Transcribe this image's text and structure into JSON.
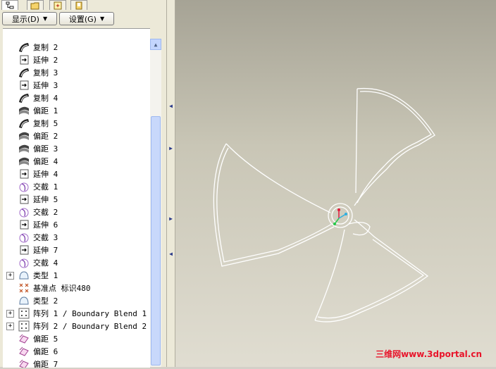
{
  "toolbar": {
    "show_label": "显示(D)",
    "settings_label": "设置(G)"
  },
  "tree_items": [
    {
      "label": "复制 2",
      "icon": "copy-surface-icon"
    },
    {
      "label": "延伸 2",
      "icon": "extend-icon"
    },
    {
      "label": "复制 3",
      "icon": "copy-surface-icon"
    },
    {
      "label": "延伸 3",
      "icon": "extend-icon"
    },
    {
      "label": "复制 4",
      "icon": "copy-surface-icon"
    },
    {
      "label": "偏距 1",
      "icon": "offset-icon"
    },
    {
      "label": "复制 5",
      "icon": "copy-surface-icon"
    },
    {
      "label": "偏距 2",
      "icon": "offset-icon"
    },
    {
      "label": "偏距 3",
      "icon": "offset-icon"
    },
    {
      "label": "偏距 4",
      "icon": "offset-icon"
    },
    {
      "label": "延伸 4",
      "icon": "extend-icon"
    },
    {
      "label": "交截 1",
      "icon": "intersect-icon"
    },
    {
      "label": "延伸 5",
      "icon": "extend-icon"
    },
    {
      "label": "交截 2",
      "icon": "intersect-icon"
    },
    {
      "label": "延伸 6",
      "icon": "extend-icon"
    },
    {
      "label": "交截 3",
      "icon": "intersect-icon"
    },
    {
      "label": "延伸 7",
      "icon": "extend-icon"
    },
    {
      "label": "交截 4",
      "icon": "intersect-icon"
    },
    {
      "label": "类型 1",
      "icon": "surface-type-icon",
      "expandable": true
    },
    {
      "label": "基准点 标识480",
      "icon": "datum-point-icon"
    },
    {
      "label": "类型 2",
      "icon": "surface-type-icon"
    },
    {
      "label": "阵列 1 / Boundary Blend 1",
      "icon": "pattern-icon",
      "expandable": true
    },
    {
      "label": "阵列 2 / Boundary Blend 2",
      "icon": "pattern-icon",
      "expandable": true
    },
    {
      "label": "偏距 5",
      "icon": "offset-pink-icon"
    },
    {
      "label": "偏距 6",
      "icon": "offset-pink-icon"
    },
    {
      "label": "偏距 7",
      "icon": "offset-pink-icon"
    }
  ],
  "watermark": "三维网www.3dportal.cn",
  "colors": {
    "panel_bg": "#ece9d8",
    "viewport_top": "#a6a395",
    "viewport_bottom": "#e0ddd1",
    "watermark": "#e8142a"
  }
}
